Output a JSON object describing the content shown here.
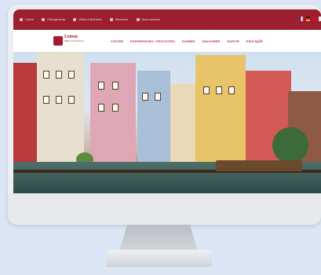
{
  "topbar": {
    "items": [
      "Colmar",
      "Hébergements",
      "Visites & itinéraires",
      "Bienvenue ",
      "Nous contacter"
    ],
    "flags": [
      "fr",
      "de",
      "en",
      "gb"
    ]
  },
  "header": {
    "logo_name": "Colmar",
    "logo_sub": "Office de Tourisme",
    "menu": [
      "VISITER",
      "EXPERIENCES / FESTIVITES",
      "DORMIR",
      "SAVOURER",
      "SORTIR",
      "PRATIQUE"
    ],
    "search_icon": "search-icon"
  },
  "colors": {
    "brand": "#a6192e",
    "topbar": "#9b1f2f"
  }
}
